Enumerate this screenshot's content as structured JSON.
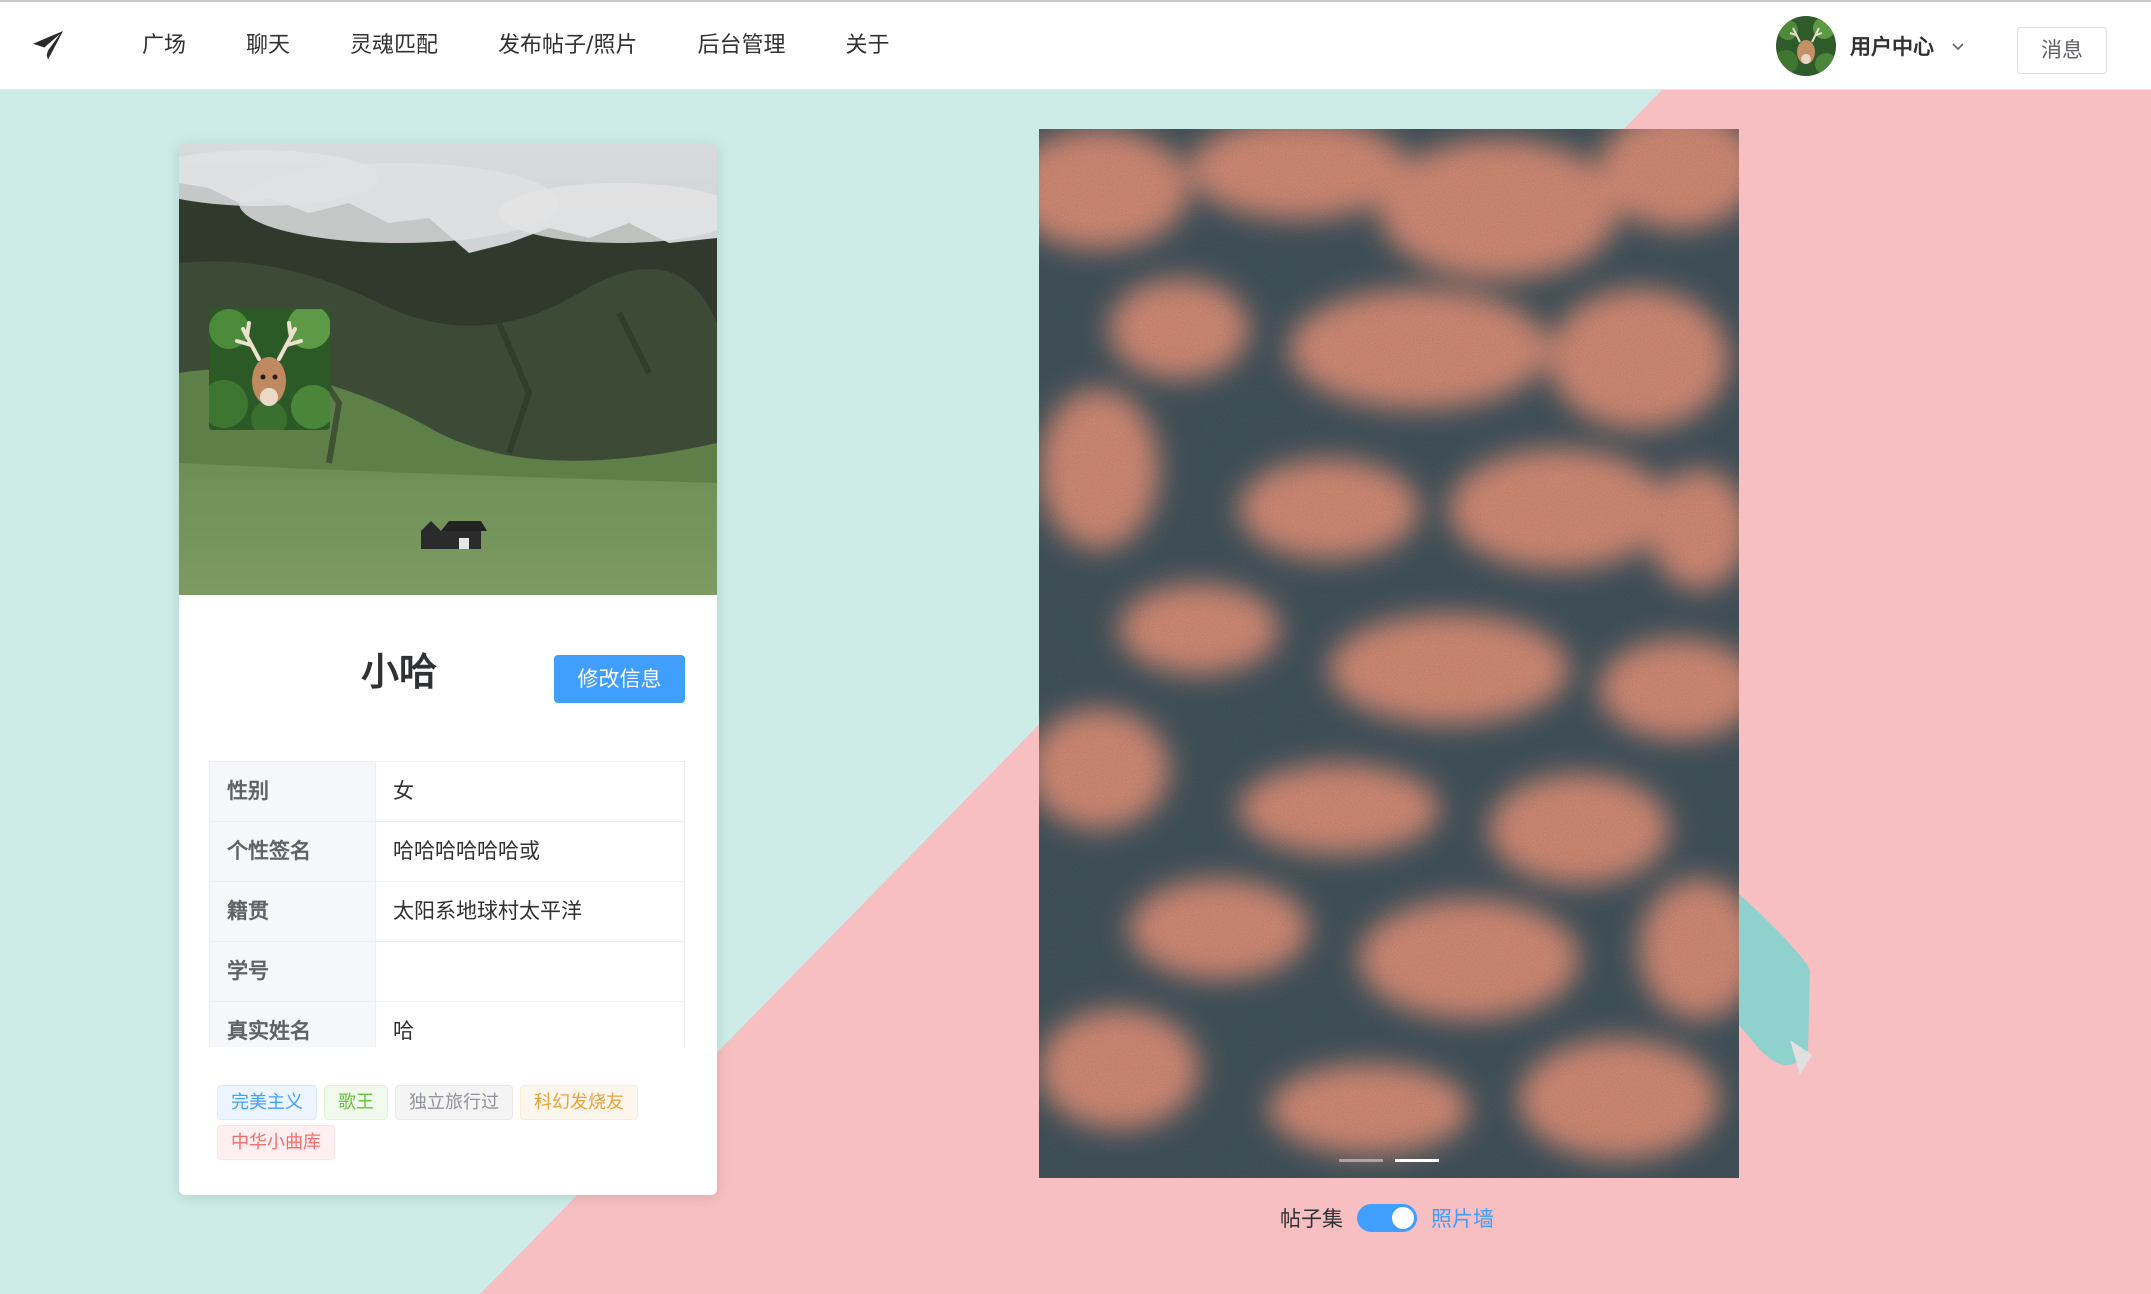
{
  "header": {
    "nav": [
      "广场",
      "聊天",
      "灵魂匹配",
      "发布帖子/照片",
      "后台管理",
      "关于"
    ],
    "user_center": "用户中心",
    "message_button": "消息",
    "logo_icon": "paper-plane-icon"
  },
  "profile": {
    "name": "小哈",
    "edit_button": "修改信息",
    "info": [
      {
        "label": "性别",
        "value": "女"
      },
      {
        "label": "个性签名",
        "value": "哈哈哈哈哈哈或"
      },
      {
        "label": "籍贯",
        "value": "太阳系地球村太平洋"
      },
      {
        "label": "学号",
        "value": ""
      },
      {
        "label": "真实姓名",
        "value": "哈"
      }
    ],
    "tags": [
      "完美主义",
      "歌王",
      "独立旅行过",
      "科幻发烧友",
      "中华小曲库"
    ]
  },
  "gallery": {
    "switch_left": "帖子集",
    "switch_right": "照片墙",
    "switch_on": true,
    "slide_count": 2,
    "active_slide": 2
  },
  "colors": {
    "primary": "#409eff",
    "bg_mint": "#cdece7",
    "bg_pink": "#f7bfc1"
  }
}
